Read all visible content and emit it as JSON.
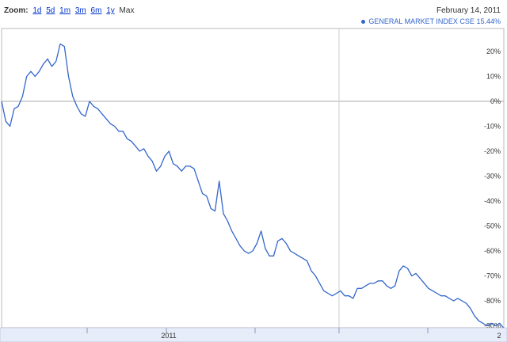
{
  "zoom": {
    "label": "Zoom:",
    "options": [
      "1d",
      "5d",
      "1m",
      "3m",
      "6m",
      "1y",
      "Max"
    ],
    "current": "Max"
  },
  "header": {
    "date": "February 14, 2011",
    "legend_series": "GENERAL MARKET INDEX CSE",
    "legend_value": "15.44%"
  },
  "colors": {
    "line": "#3366cc",
    "grid": "#cccccc",
    "axisband": "#e6ecf8"
  },
  "chart_data": {
    "type": "line",
    "series": [
      {
        "name": "GENERAL MARKET INDEX CSE",
        "values": [
          0,
          -8,
          -10,
          -3,
          -2,
          2,
          10,
          12,
          10,
          12,
          15,
          17,
          14,
          16,
          23,
          22,
          10,
          2,
          -2,
          -5,
          -6,
          0,
          -2,
          -3,
          -5,
          -7,
          -9,
          -10,
          -12,
          -12,
          -15,
          -16,
          -18,
          -20,
          -19,
          -22,
          -24,
          -28,
          -26,
          -22,
          -20,
          -25,
          -26,
          -28,
          -26,
          -26,
          -27,
          -32,
          -37,
          -38,
          -43,
          -44,
          -32,
          -45,
          -48,
          -52,
          -55,
          -58,
          -60,
          -61,
          -60,
          -57,
          -52,
          -59,
          -62,
          -62,
          -56,
          -55,
          -57,
          -60,
          -61,
          -62,
          -63,
          -64,
          -68,
          -70,
          -73,
          -76,
          -77,
          -78,
          -77,
          -76,
          -78,
          -78,
          -79,
          -75,
          -75,
          -74,
          -73,
          -73,
          -72,
          -72,
          -74,
          -75,
          -74,
          -68,
          -66,
          -67,
          -70,
          -69,
          -71,
          -73,
          -75,
          -76,
          -77,
          -78,
          -78,
          -79,
          -80,
          -79,
          -80,
          -81,
          -83,
          -86,
          -88,
          -89,
          -90,
          -89,
          -90,
          -89,
          -91
        ]
      }
    ],
    "ylim": [
      -90,
      25
    ],
    "yticks": [
      "20%",
      "10%",
      "0%",
      "-10%",
      "-20%",
      "-30%",
      "-40%",
      "-50%",
      "-60%",
      "-70%",
      "-80%",
      "-90%"
    ],
    "ytick_values": [
      20,
      10,
      0,
      -10,
      -20,
      -30,
      -40,
      -50,
      -60,
      -70,
      -80,
      -90
    ],
    "xtick_labels": [
      "2011",
      "2"
    ],
    "grid": "horizontal",
    "legend": "top-right"
  }
}
